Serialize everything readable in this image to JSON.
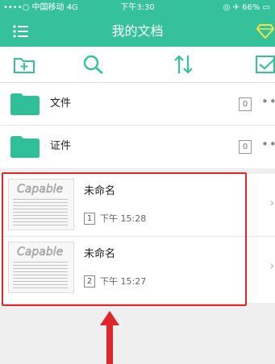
{
  "status_bar": {
    "signal_carrier": "••••○ 中国移动",
    "network": "4G",
    "time": "下午3:30",
    "battery": "66%"
  },
  "nav": {
    "title": "我的文档",
    "menu_icon": "list-menu-icon",
    "vip_icon": "diamond-icon"
  },
  "toolbar": {
    "icons": [
      "new-folder-icon",
      "search-icon",
      "sort-icon",
      "select-checkbox-icon"
    ]
  },
  "folders": [
    {
      "name": "文件",
      "count": "0",
      "more": "•••"
    },
    {
      "name": "证件",
      "count": "0",
      "more": "•••"
    }
  ],
  "documents": [
    {
      "name": "未命名",
      "pages": "1",
      "time": "下午 15:28",
      "thumb_text": "Capable"
    },
    {
      "name": "未命名",
      "pages": "2",
      "time": "下午 15:27",
      "thumb_text": "Capable"
    }
  ],
  "colors": {
    "header": "#35c19a",
    "folder": "#2fbf99",
    "annotation": "#e0262a"
  }
}
